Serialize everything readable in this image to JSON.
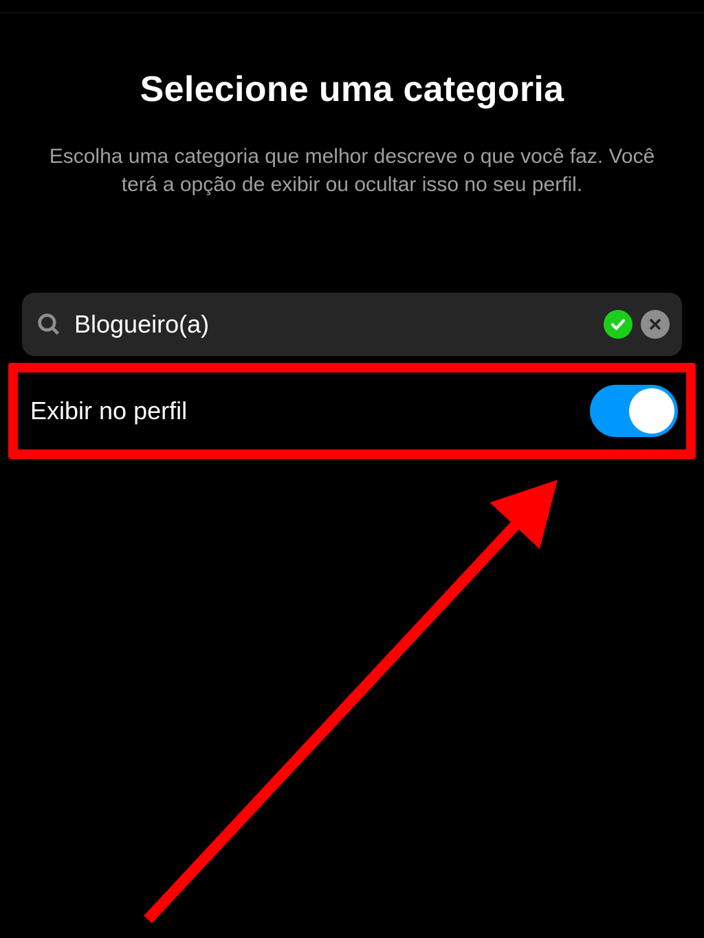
{
  "header": {
    "title": "Selecione uma categoria",
    "subtitle": "Escolha uma categoria que melhor descreve o que você faz. Você terá a opção de exibir ou ocultar isso no seu perfil."
  },
  "search": {
    "value": "Blogueiro(a)"
  },
  "toggle_row": {
    "label": "Exibir no perfil",
    "enabled": true
  },
  "annotation": {
    "highlight_color": "#fe0000",
    "arrow_color": "#fe0000"
  }
}
